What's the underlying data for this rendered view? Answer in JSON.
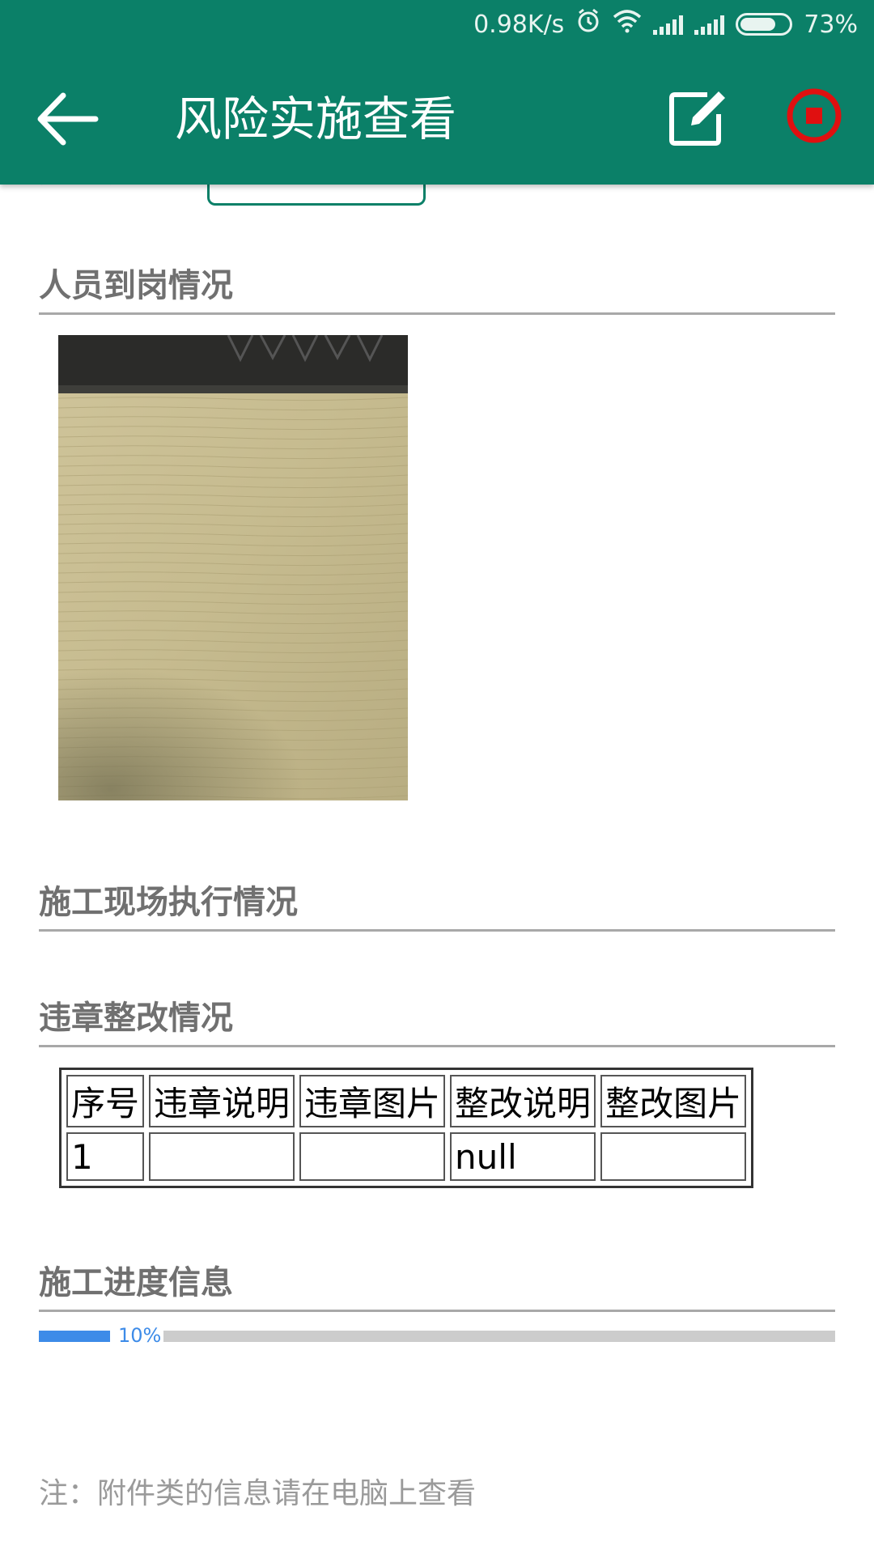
{
  "status_bar": {
    "speed": "0.98K/s",
    "battery": "73%",
    "battery_level": 0.73,
    "icons": [
      "alarm-icon",
      "wifi-icon",
      "signal-icon",
      "signal-icon",
      "battery-icon"
    ]
  },
  "toolbar": {
    "title": "风险实施查看",
    "back_icon": "arrow-left-icon",
    "edit_icon": "edit-icon",
    "stop_icon": "stop-record-icon",
    "color": "#0b8068",
    "stop_color": "#e01010"
  },
  "sections": {
    "personnel": "人员到岗情况",
    "site_execution": "施工现场执行情况",
    "violations": "违章整改情况",
    "progress": "施工进度信息"
  },
  "violations_table": {
    "headers": [
      "序号",
      "违章说明",
      "违章图片",
      "整改说明",
      "整改图片"
    ],
    "rows": [
      [
        "1",
        "",
        "",
        "null",
        ""
      ]
    ]
  },
  "progress": {
    "label": "10%",
    "value": 0.1,
    "color": "#3d8be8"
  },
  "note": "注：附件类的信息请在电脑上查看"
}
